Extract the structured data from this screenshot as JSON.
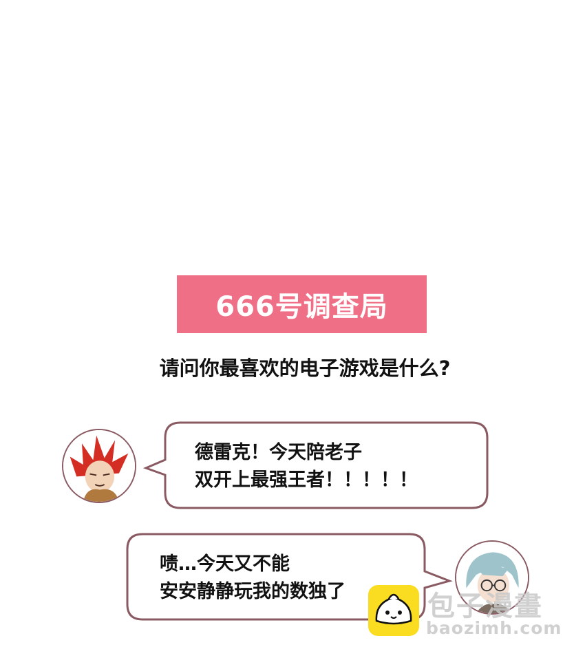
{
  "header": {
    "title": "666号调查局"
  },
  "question": "请问你最喜欢的电子游戏是什么?",
  "dialogs": [
    {
      "speaker_icon": "red-hair-character-avatar",
      "lines": [
        "德雷克！今天陪老子",
        "双开上最强王者！！！！！"
      ]
    },
    {
      "speaker_icon": "glasses-character-avatar",
      "lines": [
        "啧…今天又不能",
        "安安静静玩我的数独了"
      ]
    }
  ],
  "watermark": {
    "name": "包子漫畫",
    "url": "baozimh.com",
    "logo_icon": "bun-logo-icon"
  },
  "colors": {
    "accent": "#ef6f86",
    "bubble_border": "#8a5a63"
  }
}
